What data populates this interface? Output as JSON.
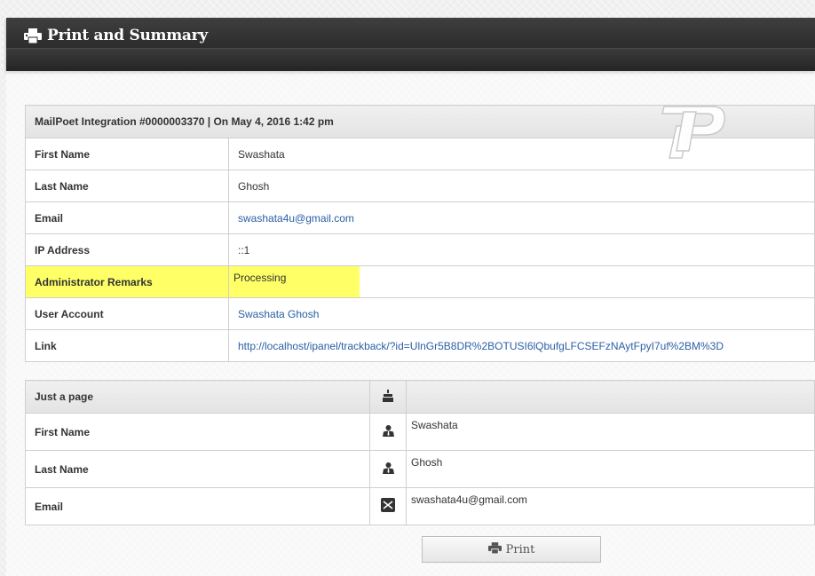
{
  "header": {
    "title": "Print and Summary",
    "icon": "printer-icon"
  },
  "entry": {
    "heading": "MailPoet Integration #0000003370 | On May 4, 2016 1:42 pm",
    "rows": [
      {
        "label": "First Name",
        "value": "Swashata"
      },
      {
        "label": "Last Name",
        "value": "Ghosh"
      },
      {
        "label": "Email",
        "value": "swashata4u@gmail.com"
      },
      {
        "label": "IP Address",
        "value": "::1"
      },
      {
        "label": "Administrator Remarks",
        "value": "Processing"
      },
      {
        "label": "User Account",
        "value": "Swashata Ghosh"
      },
      {
        "label": "Link",
        "value": "http://localhost/ipanel/trackback/?id=UlnGr5B8DR%2BOTUSI6lQbufgLFCSEFzNAytFpyI7uf%2BM%3D"
      }
    ]
  },
  "page": {
    "heading": "Just a page",
    "heading_icon": "birthday-cake-icon",
    "rows": [
      {
        "label": "First Name",
        "icon": "user-icon",
        "value": "Swashata"
      },
      {
        "label": "Last Name",
        "icon": "user-icon",
        "value": "Ghosh"
      },
      {
        "label": "Email",
        "icon": "envelope-icon",
        "value": "swashata4u@gmail.com"
      }
    ]
  },
  "print_button": {
    "label": "Print",
    "icon": "printer-icon"
  },
  "colors": {
    "header": "#2e2e2e",
    "highlight": "#ffff66",
    "link": "#2a5fa5"
  }
}
